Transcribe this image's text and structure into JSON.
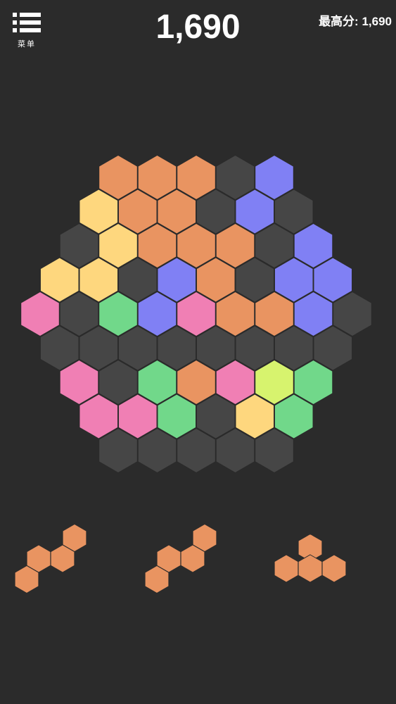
{
  "header": {
    "menu_label": "菜单",
    "score": "1,690",
    "best_score": "最高分: 1,690"
  },
  "colors": {
    "background": "#2b2b2b",
    "empty": "#464646",
    "orange": "#e99461",
    "yellow": "#fed77e",
    "blue": "#8080f4",
    "pink": "#f07fb4",
    "green": "#71d88a",
    "lime": "#d7f36e"
  },
  "board": {
    "rows": [
      [
        "orange",
        "orange",
        "orange",
        "empty",
        "blue"
      ],
      [
        "yellow",
        "orange",
        "orange",
        "empty",
        "blue",
        "empty"
      ],
      [
        "empty",
        "yellow",
        "orange",
        "orange",
        "orange",
        "empty",
        "blue"
      ],
      [
        "yellow",
        "yellow",
        "empty",
        "blue",
        "orange",
        "empty",
        "blue",
        "blue"
      ],
      [
        "pink",
        "empty",
        "green",
        "blue",
        "pink",
        "orange",
        "orange",
        "blue",
        "empty"
      ],
      [
        "empty",
        "empty",
        "empty",
        "empty",
        "empty",
        "empty",
        "empty",
        "empty"
      ],
      [
        "pink",
        "empty",
        "green",
        "orange",
        "pink",
        "lime",
        "green"
      ],
      [
        "pink",
        "pink",
        "green",
        "empty",
        "yellow",
        "green"
      ],
      [
        "empty",
        "empty",
        "empty",
        "empty",
        "empty"
      ]
    ]
  },
  "pieces": [
    {
      "color": "orange",
      "cells": [
        [
          0,
          0
        ],
        [
          1,
          -1
        ],
        [
          1,
          0
        ],
        [
          2,
          -1
        ]
      ]
    },
    {
      "color": "orange",
      "cells": [
        [
          0,
          0
        ],
        [
          1,
          -1
        ],
        [
          1,
          0
        ],
        [
          2,
          -1
        ]
      ]
    },
    {
      "color": "orange",
      "cells": [
        [
          0,
          0
        ],
        [
          1,
          -1
        ],
        [
          1,
          0
        ],
        [
          1,
          1
        ]
      ]
    }
  ]
}
